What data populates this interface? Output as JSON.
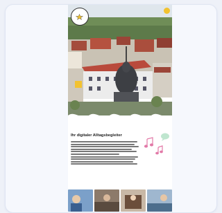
{
  "logo": {
    "text": ""
  },
  "article": {
    "title": "Ihr digitaler Alltagsbegleiter",
    "title_line2": "",
    "paragraph_lines": 12
  },
  "colors": {
    "accent": "#f2c230",
    "background": "#eef1f8",
    "roof": "#b94a3c"
  },
  "icons": [
    "star-logo-icon",
    "menu-dot-icon",
    "music-note-icon",
    "speech-bubble-icon"
  ]
}
